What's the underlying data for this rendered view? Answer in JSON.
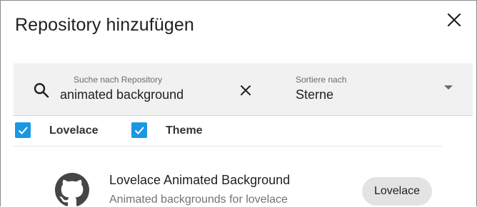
{
  "dialog": {
    "title": "Repository hinzufügen"
  },
  "search": {
    "label": "Suche nach Repository",
    "value": "animated background"
  },
  "sort": {
    "label": "Sortiere nach",
    "value": "Sterne"
  },
  "filters": [
    {
      "label": "Lovelace",
      "checked": true
    },
    {
      "label": "Theme",
      "checked": true
    }
  ],
  "repositories": [
    {
      "name": "Lovelace Animated Background",
      "description": "Animated backgrounds for lovelace",
      "category": "Lovelace",
      "icon": "github-icon"
    }
  ],
  "colors": {
    "accent": "#1b97e4",
    "filter_background": "#f1f1f1",
    "chip_background": "#e3e3e3"
  }
}
